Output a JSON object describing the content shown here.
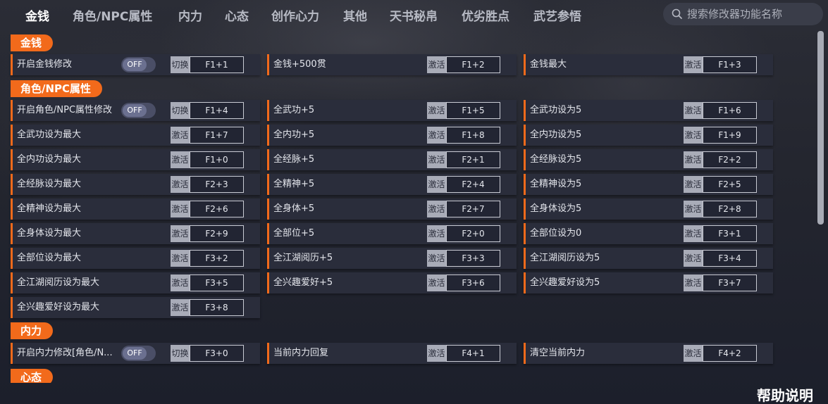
{
  "nav": {
    "tabs": [
      "金钱",
      "角色/NPC属性",
      "内力",
      "心态",
      "创作心力",
      "其他",
      "天书秘帛",
      "优劣胜点",
      "武艺参悟"
    ],
    "active_index": 0
  },
  "search": {
    "placeholder": "搜索修改器功能名称"
  },
  "sections": [
    {
      "label": "金钱",
      "items": [
        {
          "label": "开启金钱修改",
          "toggle": "OFF",
          "action": "切换",
          "hotkey": "F1+1"
        },
        {
          "label": "金钱+500贯",
          "action": "激活",
          "hotkey": "F1+2"
        },
        {
          "label": "金钱最大",
          "action": "激活",
          "hotkey": "F1+3"
        }
      ]
    },
    {
      "label": "角色/NPC属性",
      "items": [
        {
          "label": "开启角色/NPC属性修改",
          "toggle": "OFF",
          "action": "切换",
          "hotkey": "F1+4"
        },
        {
          "label": "全武功+5",
          "action": "激活",
          "hotkey": "F1+5"
        },
        {
          "label": "全武功设为5",
          "action": "激活",
          "hotkey": "F1+6"
        },
        {
          "label": "全武功设为最大",
          "action": "激活",
          "hotkey": "F1+7"
        },
        {
          "label": "全内功+5",
          "action": "激活",
          "hotkey": "F1+8"
        },
        {
          "label": "全内功设为5",
          "action": "激活",
          "hotkey": "F1+9"
        },
        {
          "label": "全内功设为最大",
          "action": "激活",
          "hotkey": "F1+0"
        },
        {
          "label": "全经脉+5",
          "action": "激活",
          "hotkey": "F2+1"
        },
        {
          "label": "全经脉设为5",
          "action": "激活",
          "hotkey": "F2+2"
        },
        {
          "label": "全经脉设为最大",
          "action": "激活",
          "hotkey": "F2+3"
        },
        {
          "label": "全精神+5",
          "action": "激活",
          "hotkey": "F2+4"
        },
        {
          "label": "全精神设为5",
          "action": "激活",
          "hotkey": "F2+5"
        },
        {
          "label": "全精神设为最大",
          "action": "激活",
          "hotkey": "F2+6"
        },
        {
          "label": "全身体+5",
          "action": "激活",
          "hotkey": "F2+7"
        },
        {
          "label": "全身体设为5",
          "action": "激活",
          "hotkey": "F2+8"
        },
        {
          "label": "全身体设为最大",
          "action": "激活",
          "hotkey": "F2+9"
        },
        {
          "label": "全部位+5",
          "action": "激活",
          "hotkey": "F2+0"
        },
        {
          "label": "全部位设为0",
          "action": "激活",
          "hotkey": "F3+1"
        },
        {
          "label": "全部位设为最大",
          "action": "激活",
          "hotkey": "F3+2"
        },
        {
          "label": "全江湖阅历+5",
          "action": "激活",
          "hotkey": "F3+3"
        },
        {
          "label": "全江湖阅历设为5",
          "action": "激活",
          "hotkey": "F3+4"
        },
        {
          "label": "全江湖阅历设为最大",
          "action": "激活",
          "hotkey": "F3+5"
        },
        {
          "label": "全兴趣爱好+5",
          "action": "激活",
          "hotkey": "F3+6"
        },
        {
          "label": "全兴趣爱好设为5",
          "action": "激活",
          "hotkey": "F3+7"
        },
        {
          "label": "全兴趣爱好设为最大",
          "action": "激活",
          "hotkey": "F3+8"
        }
      ]
    },
    {
      "label": "内力",
      "items": [
        {
          "label": "开启内力修改[角色/N...",
          "toggle": "OFF",
          "action": "切换",
          "hotkey": "F3+0"
        },
        {
          "label": "当前内力回复",
          "action": "激活",
          "hotkey": "F4+1"
        },
        {
          "label": "清空当前内力",
          "action": "激活",
          "hotkey": "F4+2"
        }
      ]
    },
    {
      "label": "心态",
      "items": []
    }
  ],
  "help": {
    "label": "帮助说明"
  },
  "colors": {
    "accent": "#f26a1b",
    "background": "#1b1e2b",
    "cell": "#2a2d3b"
  }
}
